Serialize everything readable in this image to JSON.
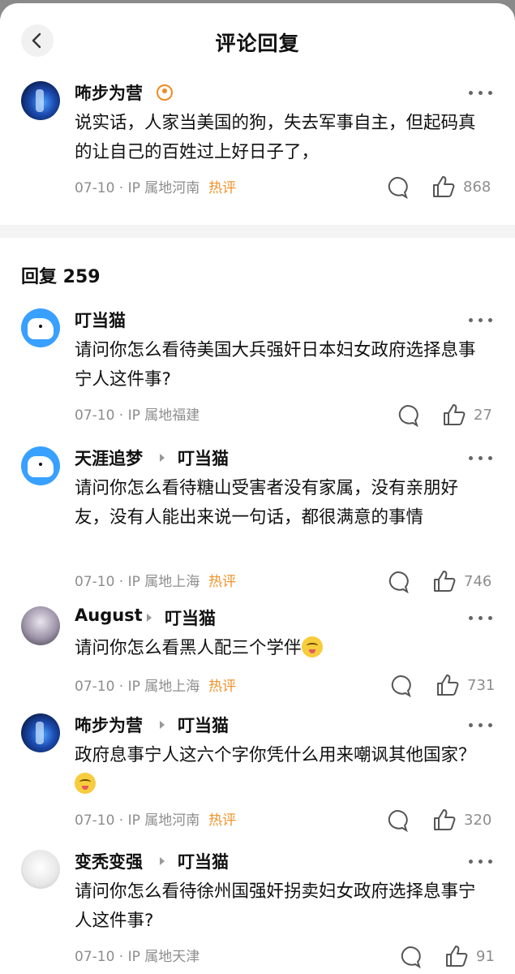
{
  "header": {
    "title": "评论回复"
  },
  "main_comment": {
    "username": "咘步为营",
    "content": "说实话，人家当美国的狗，失去军事自主，但起码真的让自己的百姓过上好日子了，",
    "date": "07-10",
    "location": "IP 属地河南",
    "hot_label": "热评",
    "likes": "868"
  },
  "replies_header": "回复 259",
  "replies": [
    {
      "username": "叮当猫",
      "target": "",
      "content": "请问你怎么看待美国大兵强奸日本妇女政府选择息事宁人这件事?",
      "date": "07-10",
      "location": "IP 属地福建",
      "hot_label": "",
      "likes": "27"
    },
    {
      "username": "天涯追梦",
      "target": "叮当猫",
      "content": "请问你怎么看待糖山受害者没有家属，没有亲朋好友，没有人能出来说一句话，都很满意的事情",
      "date": "07-10",
      "location": "IP 属地上海",
      "hot_label": "热评",
      "likes": "746"
    },
    {
      "username": "August",
      "target": "叮当猫",
      "content": "请问你怎么看黑人配三个学伴",
      "date": "07-10",
      "location": "IP 属地上海",
      "hot_label": "热评",
      "likes": "731"
    },
    {
      "username": "咘步为营",
      "target": "叮当猫",
      "content": "政府息事宁人这六个字你凭什么用来嘲讽其他国家？",
      "date": "07-10",
      "location": "IP 属地河南",
      "hot_label": "热评",
      "likes": "320"
    },
    {
      "username": "变秃变强",
      "target": "叮当猫",
      "content": "请问你怎么看待徐州国强奸拐卖妇女政府选择息事宁人这件事?",
      "date": "07-10",
      "location": "IP 属地天津",
      "hot_label": "",
      "likes": "91"
    }
  ],
  "icons": {
    "back": "chevron-left-icon",
    "more": "more-dots-icon",
    "comment": "comment-bubble-icon",
    "like": "thumbs-up-icon",
    "badge": "user-badge-icon",
    "emoji": "woozy-emoji-icon"
  },
  "colors": {
    "hot": "#f0932b",
    "meta": "#8d8d8d",
    "background": "#ffffff",
    "divider": "#f4f4f4"
  }
}
